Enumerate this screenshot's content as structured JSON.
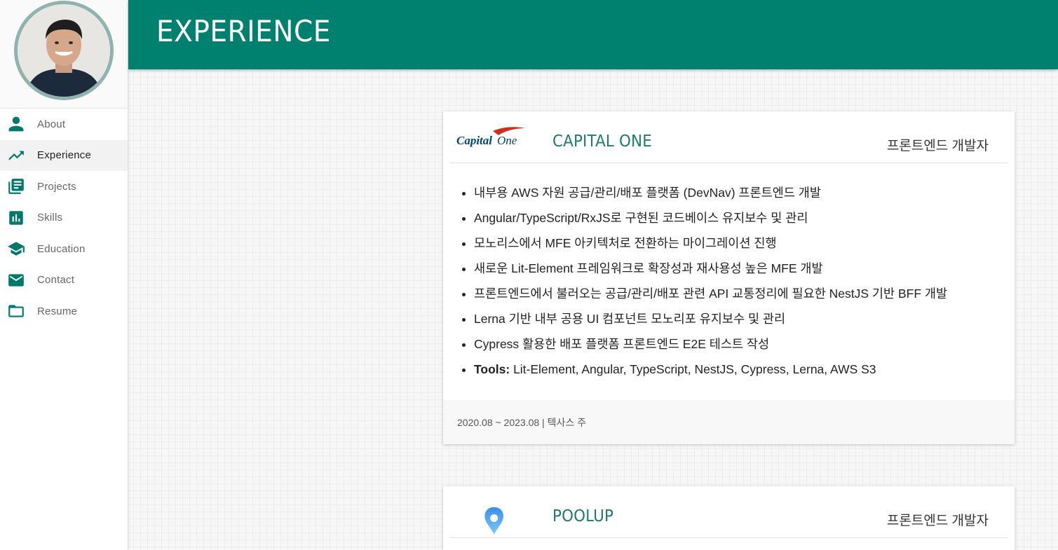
{
  "sidebar": {
    "avatar_alt": "profile-photo",
    "items": [
      {
        "label": "About",
        "icon": "person-icon",
        "active": false
      },
      {
        "label": "Experience",
        "icon": "trending-up-icon",
        "active": true
      },
      {
        "label": "Projects",
        "icon": "library-books-icon",
        "active": false
      },
      {
        "label": "Skills",
        "icon": "bar-chart-icon",
        "active": false
      },
      {
        "label": "Education",
        "icon": "school-icon",
        "active": false
      },
      {
        "label": "Contact",
        "icon": "mail-icon",
        "active": false
      },
      {
        "label": "Resume",
        "icon": "folder-icon",
        "active": false
      }
    ]
  },
  "header": {
    "title": "EXPERIENCE"
  },
  "experiences": [
    {
      "company": "CAPITAL ONE",
      "logo_text": "Capital One",
      "role": "프론트엔드 개발자",
      "bullets": [
        "내부용 AWS 자원 공급/관리/배포 플랫폼 (DevNav) 프론트엔드 개발",
        "Angular/TypeScript/RxJS로 구현된 코드베이스 유지보수 및 관리",
        "모노리스에서 MFE 아키텍처로 전환하는 마이그레이션 진행",
        "새로운 Lit-Element 프레임워크로 확장성과 재사용성 높은 MFE 개발",
        "프론트엔드에서 불러오는 공급/관리/배포 관련 API 교통정리에 필요한 NestJS 기반 BFF 개발",
        "Lerna 기반 내부 공용 UI 컴포넌트 모노리포 유지보수 및 관리",
        "Cypress 활용한 배포 플랫폼 프론트엔드 E2E 테스트 작성"
      ],
      "tools_label": "Tools:",
      "tools": " Lit-Element, Angular, TypeScript, NestJS, Cypress, Lerna, AWS S3",
      "footer": "2020.08 ~ 2023.08 | 텍사스 주"
    },
    {
      "company": "POOLUP",
      "logo_icon": "location-pin-icon",
      "role": "프론트엔드 개발자"
    }
  ],
  "colors": {
    "primary": "#00806f",
    "accent_text": "#1e7a70"
  }
}
